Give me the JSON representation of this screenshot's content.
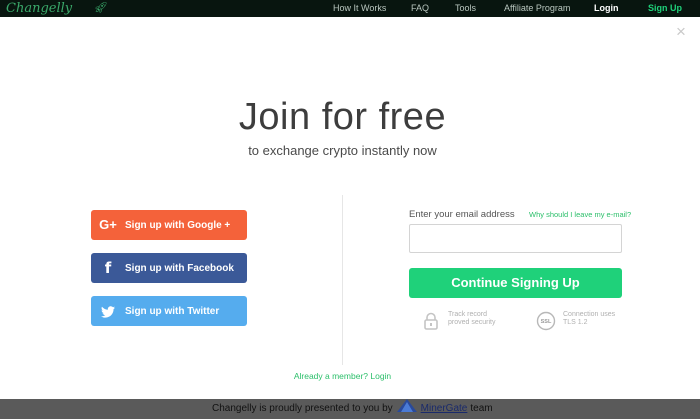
{
  "header": {
    "logo_text": "Changelly",
    "logo_icon": "rocket-icon",
    "nav": [
      {
        "label": "How It Works"
      },
      {
        "label": "FAQ"
      },
      {
        "label": "Tools"
      },
      {
        "label": "Affiliate Program"
      },
      {
        "label": "Login"
      },
      {
        "label": "Sign Up"
      }
    ]
  },
  "modal": {
    "close_symbol": "×",
    "title": "Join for free",
    "subtitle": "to exchange crypto instantly now",
    "social": {
      "google_icon": "G+",
      "google_label": "Sign up with Google +",
      "facebook_icon": "f",
      "facebook_label": "Sign up with Facebook",
      "twitter_label": "Sign up with Twitter"
    },
    "email": {
      "label": "Enter your email address",
      "why_link": "Why should I leave my e-mail?",
      "value": "",
      "placeholder": ""
    },
    "continue_label": "Continue Signing Up",
    "features": {
      "security_text": "Track record proved security",
      "tls_badge": "SSL",
      "tls_text": "Connection uses TLS 1.2"
    },
    "member_link": "Already a member? Login"
  },
  "footer": {
    "text_before": "Changelly is proudly presented to you by",
    "link": "MinerGate",
    "text_after": "team"
  },
  "colors": {
    "accent_green": "#1fd17a",
    "google": "#f4623a",
    "facebook": "#3b5998",
    "twitter": "#55acee"
  }
}
